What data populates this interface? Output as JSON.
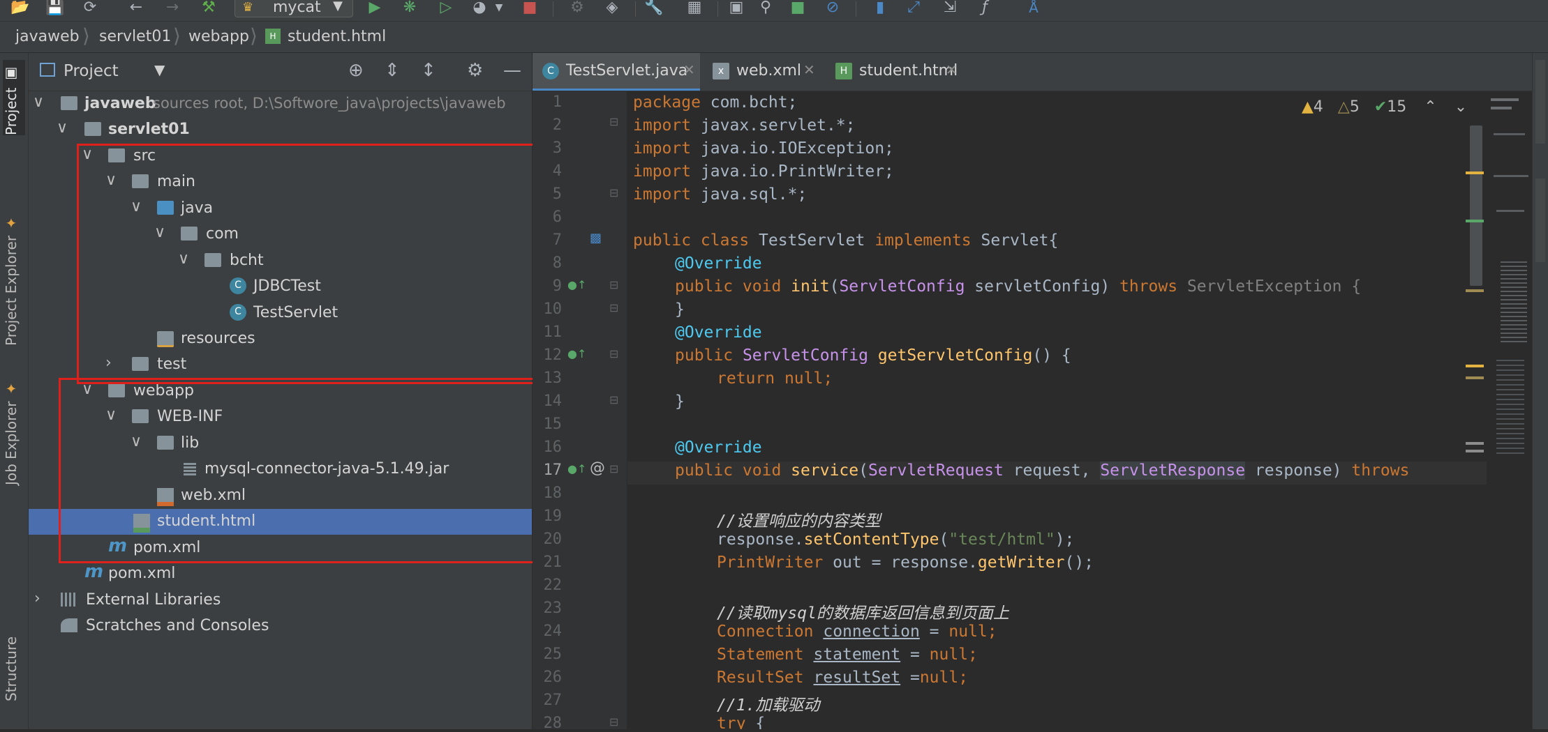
{
  "toolbar": {
    "run_config": "mycat",
    "icons": [
      "open-folder-icon",
      "save-icon",
      "sync-icon",
      "back-icon",
      "forward-icon",
      "build-hammer-icon",
      "run-icon",
      "debug-icon",
      "coverage-icon",
      "profile-icon",
      "stop-icon",
      "attach-icon",
      "build-artifacts-icon",
      "wrench-icon",
      "project-structure-icon",
      "terminal-icon",
      "search-icon",
      "graph-icon",
      "block-icon",
      "database-icon",
      "vcs-icon",
      "export-icon",
      "fx-icon",
      "translate-icon"
    ]
  },
  "breadcrumb": [
    "javaweb",
    "servlet01",
    "webapp",
    "student.html"
  ],
  "left_stripe": {
    "tabs": [
      "Project",
      "Project Explorer",
      "Job Explorer",
      "Structure"
    ]
  },
  "project_panel": {
    "title": "Project",
    "tree": [
      {
        "label": "javaweb",
        "sub": "sources root,  D:\\Softwore_java\\projects\\javaweb",
        "depth": 0,
        "open": true,
        "icon": "module-folder"
      },
      {
        "label": "servlet01",
        "depth": 1,
        "open": true,
        "icon": "module-folder"
      },
      {
        "label": "src",
        "depth": 2,
        "open": true,
        "icon": "folder"
      },
      {
        "label": "main",
        "depth": 3,
        "open": true,
        "icon": "folder"
      },
      {
        "label": "java",
        "depth": 4,
        "open": true,
        "icon": "source-folder"
      },
      {
        "label": "com",
        "depth": 5,
        "open": true,
        "icon": "package"
      },
      {
        "label": "bcht",
        "depth": 6,
        "open": true,
        "icon": "package"
      },
      {
        "label": "JDBCTest",
        "depth": 7,
        "icon": "class"
      },
      {
        "label": "TestServlet",
        "depth": 7,
        "icon": "class"
      },
      {
        "label": "resources",
        "depth": 4,
        "icon": "resources-folder"
      },
      {
        "label": "test",
        "depth": 3,
        "open": false,
        "icon": "folder"
      },
      {
        "label": "webapp",
        "depth": 2,
        "open": true,
        "icon": "folder"
      },
      {
        "label": "WEB-INF",
        "depth": 3,
        "open": true,
        "icon": "folder"
      },
      {
        "label": "lib",
        "depth": 4,
        "open": true,
        "icon": "folder"
      },
      {
        "label": "mysql-connector-java-5.1.49.jar",
        "depth": 5,
        "icon": "jar"
      },
      {
        "label": "web.xml",
        "depth": 4,
        "icon": "xml"
      },
      {
        "label": "student.html",
        "depth": 3,
        "icon": "html",
        "selected": true
      },
      {
        "label": "pom.xml",
        "depth": 2,
        "icon": "maven"
      },
      {
        "label": "pom.xml",
        "depth": 1,
        "icon": "maven"
      },
      {
        "label": "External Libraries",
        "depth": 0,
        "open": false,
        "icon": "libraries"
      },
      {
        "label": "Scratches and Consoles",
        "depth": 0,
        "icon": "scratches"
      }
    ]
  },
  "editor_tabs": [
    {
      "label": "TestServlet.java",
      "active": true
    },
    {
      "label": "web.xml",
      "active": false
    },
    {
      "label": "student.html",
      "active": false
    }
  ],
  "inspections": {
    "errors": "4",
    "warnings": "5",
    "ok": "15"
  },
  "code_lines": [
    "1",
    "2",
    "3",
    "4",
    "5",
    "6",
    "7",
    "8",
    "9",
    "10",
    "11",
    "12",
    "13",
    "14",
    "15",
    "16",
    "17",
    "18",
    "19",
    "20",
    "21",
    "22",
    "23",
    "24",
    "25",
    "26",
    "27",
    "28"
  ],
  "code": {
    "l1": [
      "package",
      " com.bcht;"
    ],
    "l2": [
      "import",
      " javax.servlet.*;"
    ],
    "l3": [
      "import",
      " java.io.IOException;"
    ],
    "l4": [
      "import",
      " java.io.PrintWriter;"
    ],
    "l5": [
      "import",
      " java.sql.*;"
    ],
    "l7": [
      "public class",
      " TestServlet ",
      "implements",
      " Servlet{"
    ],
    "l8": "@Override",
    "l9": [
      "public void",
      " init",
      "(",
      "ServletConfig",
      " servletConfig) ",
      "throws",
      " ServletException {"
    ],
    "l10": "}",
    "l11": "@Override",
    "l12": [
      "public",
      " ServletConfig",
      " getServletConfig",
      "() {"
    ],
    "l13": [
      "return",
      " null;"
    ],
    "l14": "}",
    "l16": "@Override",
    "l17": [
      "public void",
      " service",
      "(",
      "ServletRequest",
      " request, ",
      "ServletResponse",
      " response) ",
      "throws"
    ],
    "l19": "//设置响应的内容类型",
    "l20": [
      "response.",
      "setContentType",
      "(",
      "\"test/html\"",
      ");"
    ],
    "l21": [
      "PrintWriter",
      " out = response.",
      "getWriter",
      "();"
    ],
    "l23": "//读取mysql的数据库返回信息到页面上",
    "l24": [
      "Connection",
      " ",
      "connection",
      " = ",
      "null;"
    ],
    "l25": [
      "Statement",
      " ",
      "statement",
      " = ",
      "null;"
    ],
    "l26": [
      "ResultSet",
      " ",
      "resultSet",
      " =",
      "null;"
    ],
    "l27": "//1.加载驱动",
    "l28": [
      "try",
      " {"
    ]
  },
  "colors": {
    "selection": "#4b6eaf",
    "highlight_box": "#e0201a",
    "keyword": "#cc7832",
    "annotation": "#bbb529"
  }
}
